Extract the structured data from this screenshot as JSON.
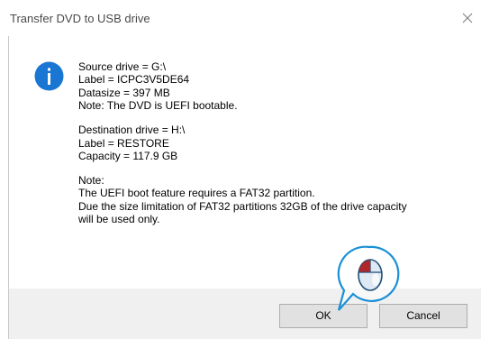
{
  "window": {
    "title": "Transfer DVD to USB drive"
  },
  "icons": {
    "message_icon": "info-icon",
    "close_icon": "close-icon",
    "pointer_icon": "mouse-click-icon"
  },
  "message": {
    "source": [
      "Source drive = G:\\",
      "Label = ICPC3V5DE64",
      "Datasize = 397 MB",
      "Note: The DVD is UEFI bootable."
    ],
    "destination": [
      "Destination drive = H:\\",
      "Label = RESTORE",
      "Capacity = 117.9 GB"
    ],
    "note": [
      "Note:",
      "The UEFI boot feature requires a FAT32 partition.",
      "Due the size limitation of FAT32 partitions 32GB of the drive capacity",
      "will be used only."
    ]
  },
  "buttons": {
    "ok_label": "OK",
    "cancel_label": "Cancel"
  },
  "colors": {
    "info_icon": "#1976d2",
    "footer_bg": "#f0f0f0",
    "cursor_callout": "#1a8fd6",
    "mouse_button": "#b0272a"
  }
}
